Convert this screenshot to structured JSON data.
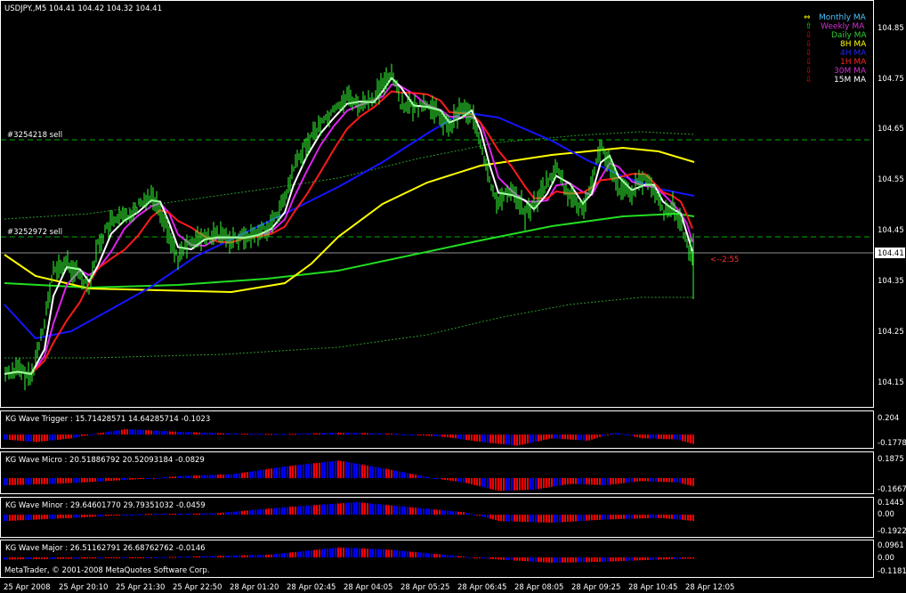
{
  "symbol_header": "USDJPY.,M5  104.41 104.42 104.32 104.41",
  "main_axis": {
    "price_labels": [
      "104.85",
      "104.75",
      "104.65",
      "104.55",
      "104.45",
      "104.35",
      "104.25",
      "104.15"
    ],
    "current_price": "104.41"
  },
  "orders": [
    {
      "label": "#3254218 sell",
      "price": 104.63
    },
    {
      "label": "#3252972 sell",
      "price": 104.44
    }
  ],
  "countdown": "<--2:55",
  "ma_legend": [
    {
      "icon": "updown-arrow-icon",
      "glyph": "⇔",
      "label": "Monthly MA",
      "color": "#4fc3ff",
      "icon_color": "#ffff00"
    },
    {
      "icon": "up-arrow-icon",
      "glyph": "⇧",
      "label": "Weekly MA",
      "color": "#cc33cc",
      "icon_color": "#00ff00"
    },
    {
      "icon": "down-arrow-icon",
      "glyph": "⇩",
      "label": "Daily MA",
      "color": "#33cc33",
      "icon_color": "#ff0000"
    },
    {
      "icon": "down-arrow-icon",
      "glyph": "⇩",
      "label": "8H MA",
      "color": "#ffff00",
      "icon_color": "#ff0000"
    },
    {
      "icon": "down-arrow-icon",
      "glyph": "⇩",
      "label": "4H MA",
      "color": "#2222ff",
      "icon_color": "#ff0000"
    },
    {
      "icon": "down-arrow-icon",
      "glyph": "⇩",
      "label": "1H MA",
      "color": "#ff2222",
      "icon_color": "#ff0000"
    },
    {
      "icon": "down-arrow-icon",
      "glyph": "⇩",
      "label": "30M MA",
      "color": "#cc33cc",
      "icon_color": "#ff0000"
    },
    {
      "icon": "down-arrow-icon",
      "glyph": "⇩",
      "label": "15M MA",
      "color": "#ffffff",
      "icon_color": "#ff0000"
    }
  ],
  "panels": [
    {
      "label": "KG Wave Trigger : 15.71428571 14.64285714 -0.1023",
      "top": "0.204",
      "zero": "",
      "bottom": "-0.1778"
    },
    {
      "label": "KG Wave Micro : 20.51886792 20.52093184 -0.0829",
      "top": "0.1875",
      "zero": "",
      "bottom": "-0.1667"
    },
    {
      "label": "KG Wave Minor : 29.64601770 29.79351032 -0.0459",
      "top": "0.1445",
      "zero": "0.00",
      "bottom": "-0.1922"
    },
    {
      "label": "KG Wave Major : 26.51162791 26.68762762 -0.0146",
      "top": "0.0961",
      "zero": "0.00",
      "bottom": "-0.1181"
    }
  ],
  "copyright": "MetaTrader, © 2001-2008 MetaQuotes Software Corp.",
  "time_labels": [
    "25 Apr 2008",
    "25 Apr 20:10",
    "25 Apr 21:30",
    "25 Apr 22:50",
    "28 Apr 01:20",
    "28 Apr 02:45",
    "28 Apr 04:05",
    "28 Apr 05:25",
    "28 Apr 06:45",
    "28 Apr 08:05",
    "28 Apr 09:25",
    "28 Apr 10:45",
    "28 Apr 12:05"
  ],
  "colors": {
    "grid_dash": "#00b000",
    "axis": "#ffffff",
    "bull": "#0000ff",
    "bear": "#ff0000"
  }
}
